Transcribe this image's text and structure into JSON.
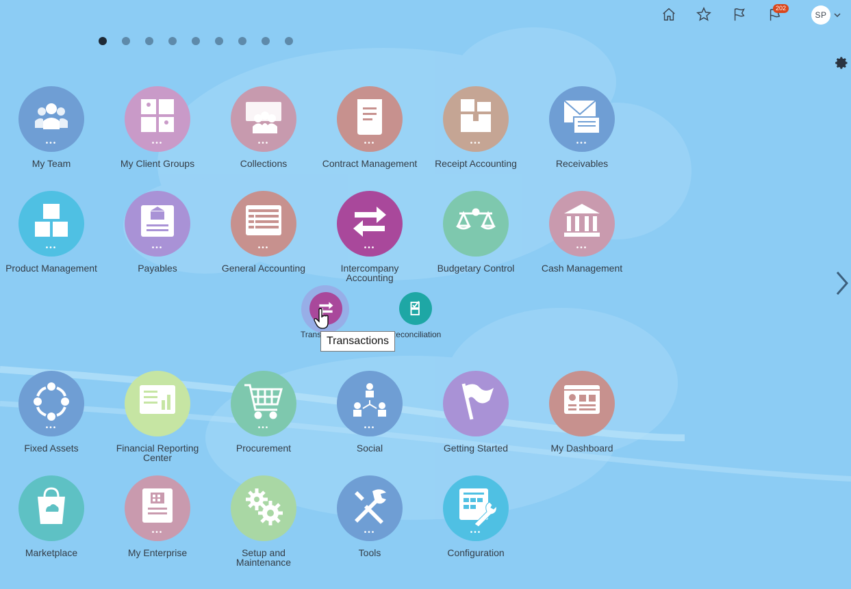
{
  "header": {
    "home_icon": "home-icon",
    "favorites_icon": "star-icon",
    "watchlist_icon": "flag-icon",
    "notifications_icon": "notification-flag-icon",
    "notifications_count": "202",
    "user_initials": "SP"
  },
  "pagination": {
    "total": 9,
    "active": 1
  },
  "tiles_row1": {
    "my_team": "My Team",
    "my_client_groups": "My Client Groups",
    "collections": "Collections",
    "contract_management": "Contract Management",
    "receipt_accounting": "Receipt Accounting",
    "receivables": "Receivables"
  },
  "tiles_row2": {
    "product_management": "Product Management",
    "payables": "Payables",
    "general_accounting": "General Accounting",
    "intercompany_accounting": "Intercompany Accounting",
    "budgetary_control": "Budgetary Control",
    "cash_management": "Cash Management"
  },
  "subgroup": {
    "transactions": "Trans",
    "reconciliation": "Reconciliation",
    "tooltip": "Transactions"
  },
  "tiles_row3": {
    "fixed_assets": "Fixed Assets",
    "financial_reporting_center": "Financial Reporting Center",
    "procurement": "Procurement",
    "social": "Social",
    "getting_started": "Getting Started",
    "my_dashboard": "My Dashboard"
  },
  "tiles_row4": {
    "marketplace": "Marketplace",
    "my_enterprise": "My Enterprise",
    "setup_and_maintenance": "Setup and Maintenance",
    "tools": "Tools",
    "configuration": "Configuration"
  },
  "colors": {
    "background": "#8cccf4",
    "tile_blue": "#6f9ed4",
    "tile_pink": "#c99ac8",
    "tile_rose": "#c79aae",
    "tile_salmon": "#c7918e",
    "tile_tan": "#c5a594",
    "tile_cyan": "#4fc0e3",
    "tile_purple": "#a992d6",
    "tile_magenta": "#a9489b",
    "tile_green": "#7ec8ae",
    "tile_lime": "#c6e5a3",
    "tile_sage": "#a9d7a4",
    "tile_teal": "#5ec1c4",
    "recon_teal": "#1ea7a5",
    "badge": "#d9471c"
  }
}
